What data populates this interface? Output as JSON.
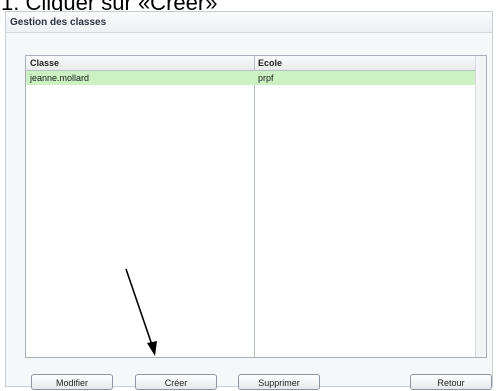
{
  "instruction": "1. Cliquer sur «Créer»",
  "window": {
    "title": "Gestion des classes"
  },
  "table": {
    "headers": [
      "Classe",
      "Ecole"
    ],
    "rows": [
      [
        "jeanne.mollard",
        "prpf"
      ]
    ]
  },
  "buttons": {
    "modifier": "Modifier",
    "creer": "Créer",
    "supprimer": "Supprimer",
    "retour": "Retour"
  },
  "colors": {
    "selected_row": "#ccf2c4",
    "window_bg": "#f6f7f9"
  }
}
